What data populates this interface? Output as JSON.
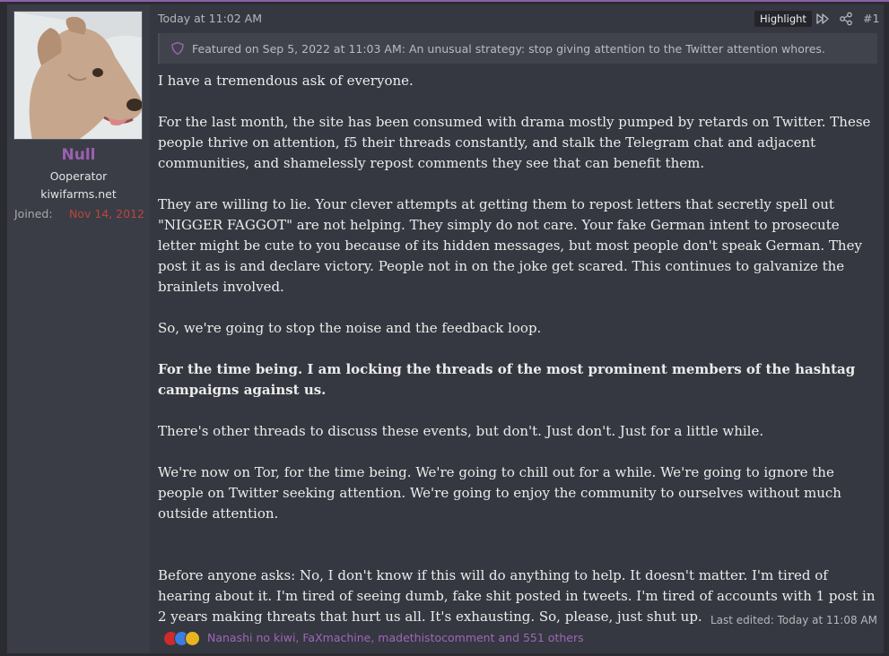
{
  "user": {
    "name": "Null",
    "title": "Ooperator",
    "subtitle": "kiwifarms.net",
    "joined_label": "Joined:",
    "joined_value": "Nov 14, 2012"
  },
  "post": {
    "timestamp": "Today at 11:02 AM",
    "highlight_label": "Highlight",
    "number": "#1",
    "featured": "Featured on Sep 5, 2022 at 11:03 AM: An unusual strategy: stop giving attention to the Twitter attention whores.",
    "paragraphs": [
      "I have a tremendous ask of everyone.",
      "For the last month, the site has been consumed with drama mostly pumped by retards on Twitter. These people thrive on attention, f5 their threads constantly, and stalk the Telegram chat and adjacent communities, and shamelessly repost comments they see that can benefit them.",
      "They are willing to lie. Your clever attempts at getting them to repost letters that secretly spell out \"NIGGER FAGGOT\" are not helping. They simply do not care. Your fake German intent to prosecute letter might be cute to you because of its hidden messages, but most people don't speak German. They post it as is and declare victory. People not in on the joke get scared. This continues to galvanize the brainlets involved.",
      "So, we're going to stop the noise and the feedback loop.",
      "For the time being. I am locking the threads of the most prominent members of the hashtag campaigns against us.",
      "There's other threads to discuss these events, but don't. Just don't. Just for a little while.",
      "We're now on Tor, for the time being. We're going to chill out for a while. We're going to ignore the people on Twitter seeking attention. We're going to enjoy the community to ourselves without much outside attention.",
      "Before anyone asks: No, I don't know if this will do anything to help. It doesn't matter. I'm tired of hearing about it. I'm tired of seeing dumb, fake shit posted in tweets. I'm tired of accounts with 1 post in 2 years making threats that hurt us all. It's exhausting. So, please, just shut up."
    ],
    "last_edited": "Last edited: Today at 11:08 AM",
    "reactions_text": "Nanashi no kiwi, FaXmachine, madethistocomment and 551 others"
  },
  "colors": {
    "accent": "#9c5fb2",
    "joined": "#b9463f",
    "reactions_link": "#a066b8",
    "background": "#353840"
  },
  "icons": [
    "shield-icon",
    "fast-forward-icon",
    "share-icon",
    "heart-reaction-icon",
    "like-reaction-icon",
    "winner-reaction-icon"
  ]
}
